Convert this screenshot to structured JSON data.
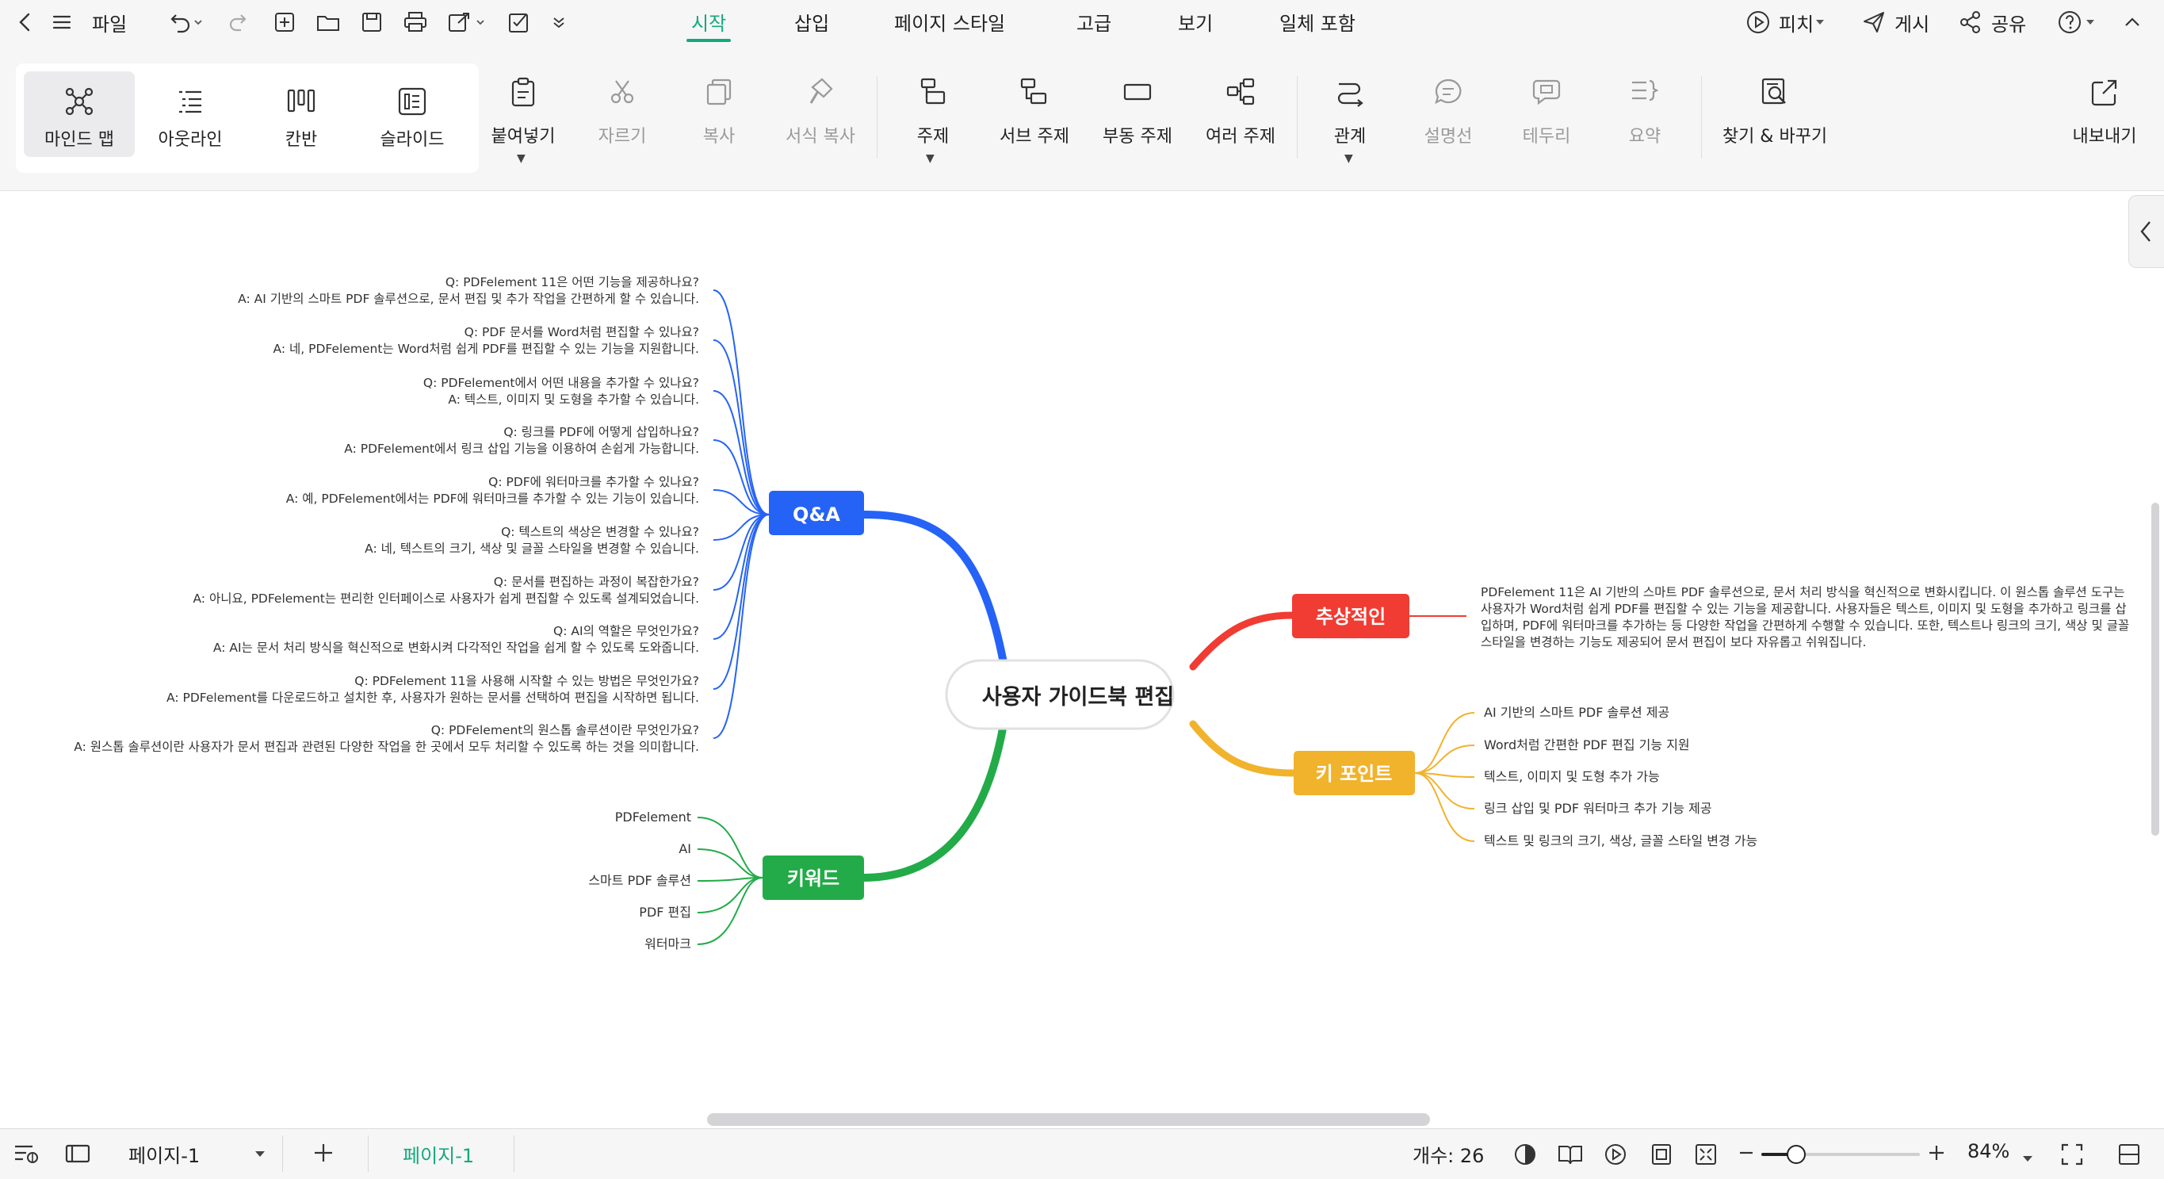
{
  "menubar": {
    "file_label": "파일",
    "tabs": [
      "시작",
      "삽입",
      "페이지 스타일",
      "고급",
      "보기",
      "일체 포함"
    ],
    "active_tab": "시작",
    "pitch_label": "피치",
    "publish_label": "게시",
    "share_label": "공유"
  },
  "ribbon": {
    "views": [
      "마인드 맵",
      "아웃라인",
      "칸반",
      "슬라이드"
    ],
    "paste": "붙여넣기",
    "cut": "자르기",
    "copy": "복사",
    "format_copy": "서식 복사",
    "topic": "주제",
    "subtopic": "서브 주제",
    "floating_topic": "부동 주제",
    "multiple_topics": "여러 주제",
    "relation": "관계",
    "callout": "설명선",
    "boundary": "테두리",
    "summary": "요약",
    "find_replace": "찾기 & 바꾸기",
    "export": "내보내기"
  },
  "mindmap": {
    "central": "사용자 가이드북 편집",
    "qa": {
      "label": "Q&A",
      "color": "#2563f6",
      "items": [
        {
          "q": "Q: PDFelement 11은 어떤 기능을 제공하나요?",
          "a": "A: AI 기반의 스마트 PDF 솔루션으로, 문서 편집 및 추가 작업을 간편하게 할 수 있습니다."
        },
        {
          "q": "Q: PDF 문서를 Word처럼 편집할 수 있나요?",
          "a": "A: 네, PDFelement는 Word처럼 쉽게 PDF를 편집할 수 있는 기능을 지원합니다."
        },
        {
          "q": "Q: PDFelement에서 어떤 내용을 추가할 수 있나요?",
          "a": "A: 텍스트, 이미지 및 도형을 추가할 수 있습니다."
        },
        {
          "q": "Q: 링크를 PDF에 어떻게 삽입하나요?",
          "a": "A: PDFelement에서 링크 삽입 기능을 이용하여 손쉽게 가능합니다."
        },
        {
          "q": "Q: PDF에 워터마크를 추가할 수 있나요?",
          "a": "A: 예, PDFelement에서는 PDF에 워터마크를 추가할 수 있는 기능이 있습니다."
        },
        {
          "q": "Q: 텍스트의 색상은 변경할 수 있나요?",
          "a": "A: 네, 텍스트의 크기, 색상 및 글꼴 스타일을 변경할 수 있습니다."
        },
        {
          "q": "Q: 문서를 편집하는 과정이 복잡한가요?",
          "a": "A: 아니요, PDFelement는 편리한 인터페이스로 사용자가 쉽게 편집할 수 있도록 설계되었습니다."
        },
        {
          "q": "Q: AI의 역할은 무엇인가요?",
          "a": "A: AI는 문서 처리 방식을 혁신적으로 변화시켜 다각적인 작업을 쉽게 할 수 있도록 도와줍니다."
        },
        {
          "q": "Q: PDFelement 11을 사용해 시작할 수 있는 방법은 무엇인가요?",
          "a": "A: PDFelement를 다운로드하고 설치한 후, 사용자가 원하는 문서를 선택하여 편집을 시작하면 됩니다."
        },
        {
          "q": "Q: PDFelement의 원스톱 솔루션이란 무엇인가요?",
          "a": "A: 원스톱 솔루션이란 사용자가 문서 편집과 관련된 다양한 작업을 한 곳에서 모두 처리할 수 있도록 하는 것을 의미합니다."
        }
      ]
    },
    "keywords": {
      "label": "키워드",
      "color": "#22ab48",
      "items": [
        "PDFelement",
        "AI",
        "스마트 PDF 솔루션",
        "PDF 편집",
        "워터마크"
      ]
    },
    "abstract": {
      "label": "추상적인",
      "color": "#f03c32",
      "lines": [
        "PDFelement 11은 AI 기반의 스마트 PDF 솔루션으로, 문서 처리 방식을 혁신적으로 변화시킵니다. 이 원스톱 솔루션 도구는",
        "사용자가 Word처럼 쉽게 PDF를 편집할 수 있는 기능을 제공합니다. 사용자들은 텍스트, 이미지 및 도형을 추가하고 링크를 삽",
        "입하며, PDF에 워터마크를 추가하는 등 다양한 작업을 간편하게 수행할 수 있습니다. 또한, 텍스트나 링크의 크기, 색상 및 글꼴",
        "스타일을 변경하는 기능도 제공되어 문서 편집이 보다 자유롭고 쉬워집니다."
      ]
    },
    "keypoints": {
      "label": "키 포인트",
      "color": "#f1b22c",
      "items": [
        "AI 기반의 스마트 PDF 솔루션 제공",
        "Word처럼 간편한 PDF 편집 기능 지원",
        "텍스트, 이미지 및 도형 추가 가능",
        "링크 삽입 및 PDF 워터마크 추가 기능 제공",
        "텍스트 및 링크의 크기, 색상, 글꼴 스타일 변경 가능"
      ]
    }
  },
  "status": {
    "page_select": "페이지-1",
    "page_tab": "페이지-1",
    "count_label": "개수: 26",
    "zoom": "84%",
    "zoom_fraction": 0.22
  }
}
